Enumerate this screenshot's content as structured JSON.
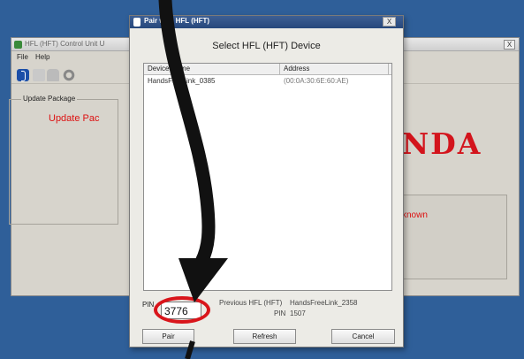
{
  "main_window": {
    "title": "HFL (HFT) Control Unit U",
    "close_label": "X",
    "menu": {
      "file": "File",
      "help": "Help"
    },
    "update_group_label": "Update Package",
    "update_text": "Update Pac",
    "brand_logo": "NDA",
    "status_text": "known",
    "icons": [
      "bluetooth-icon",
      "phone-icon",
      "car-icon",
      "gear-icon"
    ]
  },
  "dialog": {
    "title": "Pair with HFL (HFT)",
    "close_label": "X",
    "heading": "Select HFL (HFT) Device",
    "columns": {
      "name": "Device Name",
      "address": "Address"
    },
    "devices": [
      {
        "name": "HandsFreeLink_0385",
        "address": "(00:0A:30:6E:60:AE)"
      }
    ],
    "pin_label": "PIN",
    "pin_value": "3776",
    "previous_label": "Previous HFL (HFT)",
    "previous_name": "HandsFreeLink_2358",
    "previous_pin_label": "PIN",
    "previous_pin": "1507",
    "buttons": {
      "pair": "Pair",
      "refresh": "Refresh",
      "cancel": "Cancel"
    }
  },
  "colors": {
    "highlight": "#d9151b",
    "logo": "#d3141c",
    "titlebar": "#27487c",
    "desktop": "#2f5f99"
  }
}
